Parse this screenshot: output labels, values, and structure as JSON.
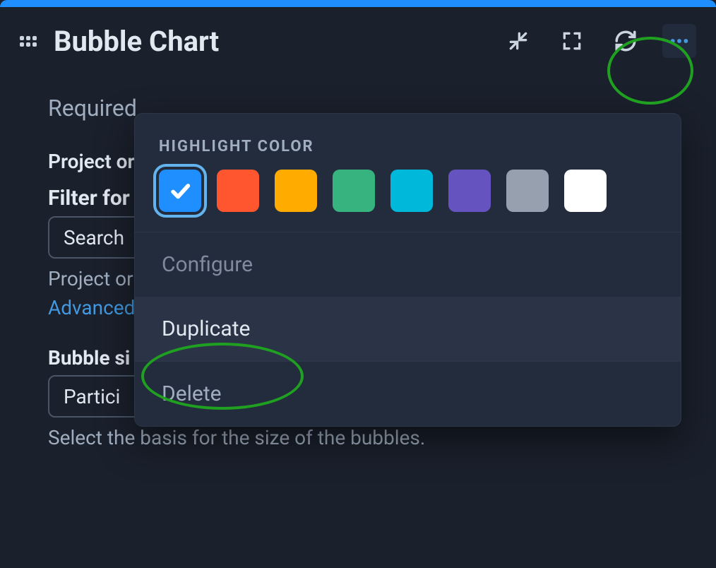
{
  "header": {
    "title": "Bubble Chart"
  },
  "form": {
    "required_label": "Required",
    "project_label": "Project or",
    "filter_label": "Filter for",
    "search_placeholder": "Search",
    "project_hint": "Project or",
    "advanced_link": "Advanced",
    "bubble_size_label": "Bubble si",
    "bubble_size_value": "Partici",
    "bubble_size_hint": "Select the basis for the size of the bubbles."
  },
  "menu": {
    "highlight_label": "HIGHLIGHT COLOR",
    "colors": {
      "blue": "#1f8fff",
      "orange": "#ff5630",
      "amber": "#ffab00",
      "green": "#36b37e",
      "cyan": "#00b8d9",
      "purple": "#6554c0",
      "gray": "#97a0af",
      "white": "#ffffff"
    },
    "selected_color": "blue",
    "items": {
      "configure": "Configure",
      "duplicate": "Duplicate",
      "delete": "Delete"
    }
  }
}
